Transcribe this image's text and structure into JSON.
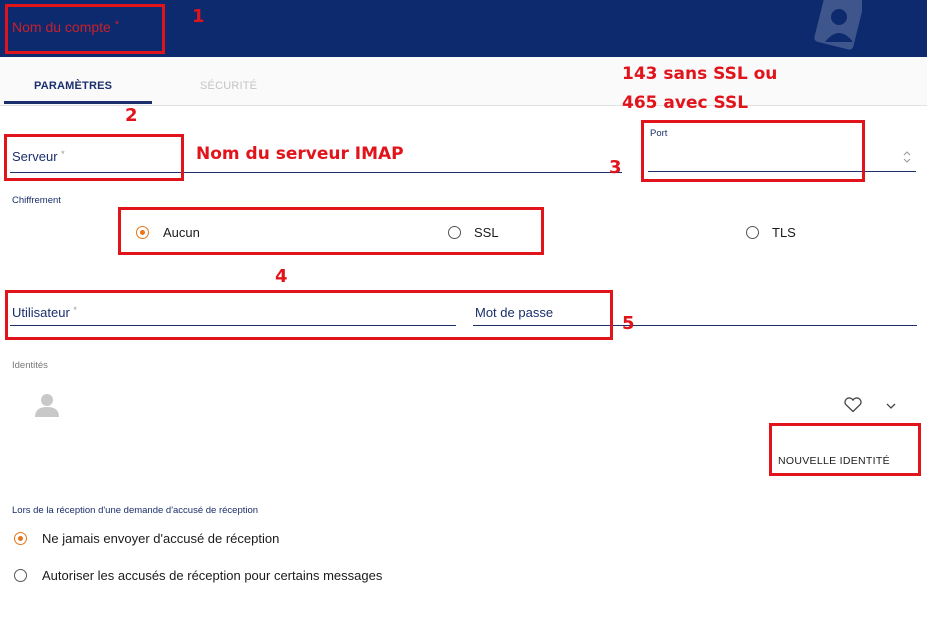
{
  "header": {
    "account_name_label": "Nom du compte",
    "account_name_required": "*"
  },
  "tabs": [
    {
      "label": "PARAMÈTRES"
    },
    {
      "label": "SÉCURITÉ"
    }
  ],
  "form": {
    "server_label": "Serveur",
    "server_required": "*",
    "port_label": "Port",
    "encryption_label": "Chiffrement",
    "encryption_options": [
      "Aucun",
      "SSL",
      "TLS"
    ],
    "encryption_selected": "Aucun",
    "user_label": "Utilisateur",
    "user_required": "*",
    "password_label": "Mot de passe"
  },
  "identities": {
    "label": "Identités",
    "new_identity_label": "NOUVELLE IDENTITÉ"
  },
  "receipt": {
    "label": "Lors de la réception d'une demande d'accusé de réception",
    "options": [
      "Ne jamais envoyer d'accusé de réception",
      "Autoriser les accusés de réception pour certains messages"
    ],
    "selected": "Ne jamais envoyer d'accusé de réception"
  },
  "annotations": {
    "n1": "1",
    "n2": "2",
    "n3": "3",
    "n4": "4",
    "n5": "5",
    "server_note": "Nom du serveur IMAP",
    "port_note_1": "143 sans SSL ou",
    "port_note_2": "465 avec SSL"
  },
  "colors": {
    "header_bg": "#0d2a6e",
    "primary": "#1a2f6b",
    "accent_orange": "#e8751a",
    "annotation_red": "#e1141c"
  }
}
